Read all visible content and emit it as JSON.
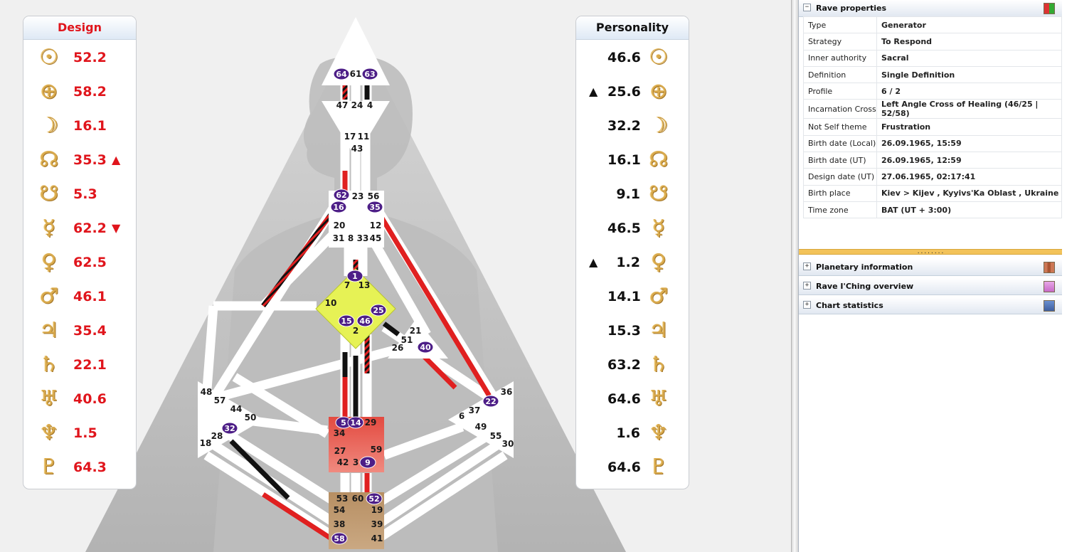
{
  "design": {
    "title": "Design",
    "rows": [
      {
        "icon": "sun-icon",
        "glyph": "☉",
        "value": "52.2",
        "arrow": ""
      },
      {
        "icon": "earth-icon",
        "glyph": "⊕",
        "value": "58.2",
        "arrow": ""
      },
      {
        "icon": "moon-icon",
        "glyph": "☽",
        "value": "16.1",
        "arrow": ""
      },
      {
        "icon": "north-node-icon",
        "glyph": "☊",
        "value": "35.3",
        "arrow": "▲"
      },
      {
        "icon": "south-node-icon",
        "glyph": "☋",
        "value": "5.3",
        "arrow": ""
      },
      {
        "icon": "mercury-icon",
        "glyph": "☿",
        "value": "62.2",
        "arrow": "▼"
      },
      {
        "icon": "venus-icon",
        "glyph": "♀",
        "value": "62.5",
        "arrow": ""
      },
      {
        "icon": "mars-icon",
        "glyph": "♂",
        "value": "46.1",
        "arrow": ""
      },
      {
        "icon": "jupiter-icon",
        "glyph": "♃",
        "value": "35.4",
        "arrow": ""
      },
      {
        "icon": "saturn-icon",
        "glyph": "♄",
        "value": "22.1",
        "arrow": ""
      },
      {
        "icon": "uranus-icon",
        "glyph": "♅",
        "value": "40.6",
        "arrow": ""
      },
      {
        "icon": "neptune-icon",
        "glyph": "♆",
        "value": "1.5",
        "arrow": ""
      },
      {
        "icon": "pluto-icon",
        "glyph": "♇",
        "value": "64.3",
        "arrow": ""
      }
    ]
  },
  "personality": {
    "title": "Personality",
    "rows": [
      {
        "icon": "sun-icon",
        "glyph": "☉",
        "value": "46.6",
        "arrow": ""
      },
      {
        "icon": "earth-icon",
        "glyph": "⊕",
        "value": "25.6",
        "arrow": "▲"
      },
      {
        "icon": "moon-icon",
        "glyph": "☽",
        "value": "32.2",
        "arrow": ""
      },
      {
        "icon": "north-node-icon",
        "glyph": "☊",
        "value": "16.1",
        "arrow": ""
      },
      {
        "icon": "south-node-icon",
        "glyph": "☋",
        "value": "9.1",
        "arrow": ""
      },
      {
        "icon": "mercury-icon",
        "glyph": "☿",
        "value": "46.5",
        "arrow": ""
      },
      {
        "icon": "venus-icon",
        "glyph": "♀",
        "value": "1.2",
        "arrow": "▲"
      },
      {
        "icon": "mars-icon",
        "glyph": "♂",
        "value": "14.1",
        "arrow": ""
      },
      {
        "icon": "jupiter-icon",
        "glyph": "♃",
        "value": "15.3",
        "arrow": ""
      },
      {
        "icon": "saturn-icon",
        "glyph": "♄",
        "value": "63.2",
        "arrow": ""
      },
      {
        "icon": "uranus-icon",
        "glyph": "♅",
        "value": "64.6",
        "arrow": ""
      },
      {
        "icon": "neptune-icon",
        "glyph": "♆",
        "value": "1.6",
        "arrow": ""
      },
      {
        "icon": "pluto-icon",
        "glyph": "♇",
        "value": "64.6",
        "arrow": ""
      }
    ]
  },
  "bodygraph": {
    "gate_numbers": [
      "64",
      "61",
      "63",
      "47",
      "24",
      "4",
      "17",
      "11",
      "43",
      "62",
      "23",
      "56",
      "16",
      "35",
      "20",
      "12",
      "31",
      "8",
      "33",
      "45",
      "1",
      "7",
      "13",
      "10",
      "15",
      "46",
      "25",
      "2",
      "21",
      "51",
      "26",
      "40",
      "48",
      "57",
      "44",
      "50",
      "32",
      "28",
      "18",
      "36",
      "22",
      "37",
      "6",
      "49",
      "55",
      "30",
      "5",
      "14",
      "29",
      "34",
      "27",
      "59",
      "42",
      "3",
      "9",
      "53",
      "60",
      "52",
      "54",
      "19",
      "38",
      "39",
      "58",
      "41"
    ],
    "highlighted_gates": [
      "64",
      "63",
      "62",
      "16",
      "35",
      "1",
      "15",
      "46",
      "25",
      "40",
      "32",
      "22",
      "5",
      "14",
      "9",
      "52",
      "58"
    ],
    "colors": {
      "design": "#e02020",
      "personality": "#111111",
      "defined_center_g": "#e6f255",
      "defined_center_sacral": "#e5544a",
      "defined_center_root": "#b48a5c",
      "gate_circle": "#4d1e87"
    }
  },
  "panel": {
    "rave_properties": {
      "title": "Rave properties",
      "rows": [
        {
          "key": "Type",
          "value": "Generator"
        },
        {
          "key": "Strategy",
          "value": "To Respond"
        },
        {
          "key": "Inner authority",
          "value": "Sacral"
        },
        {
          "key": "Definition",
          "value": "Single Definition"
        },
        {
          "key": "Profile",
          "value": "6 / 2"
        },
        {
          "key": "Incarnation Cross",
          "value": "Left Angle Cross of Healing (46/25 | 52/58)"
        },
        {
          "key": "Not Self theme",
          "value": "Frustration"
        },
        {
          "key": "Birth date (Local)",
          "value": "26.09.1965, 15:59"
        },
        {
          "key": "Birth date (UT)",
          "value": "26.09.1965, 12:59"
        },
        {
          "key": "Design date (UT)",
          "value": "27.06.1965, 02:17:41"
        },
        {
          "key": "Birth place",
          "value": "Kiev > Kijev , Kyyivs'Ka Oblast , Ukraine"
        },
        {
          "key": "Time zone",
          "value": "BAT (UT + 3:00)"
        }
      ]
    },
    "splitter_grip": "........",
    "sections": [
      {
        "label": "Planetary information",
        "icon": "planetary-info-icon"
      },
      {
        "label": "Rave I'Ching overview",
        "icon": "iching-overview-icon"
      },
      {
        "label": "Chart statistics",
        "icon": "chart-statistics-icon"
      }
    ],
    "expand_glyph": "+",
    "collapse_glyph": "−"
  }
}
